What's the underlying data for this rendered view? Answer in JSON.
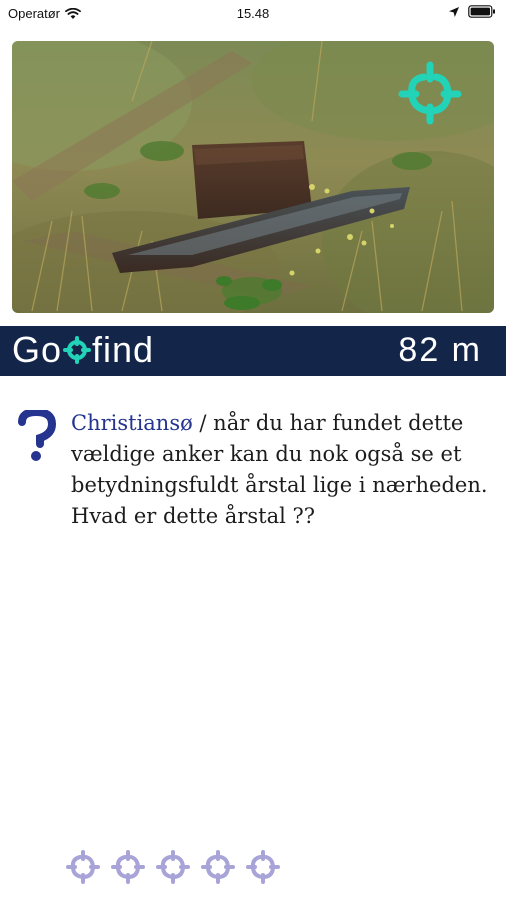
{
  "status_bar": {
    "carrier": "Operatør",
    "time": "15.48"
  },
  "brand": {
    "logo_left": "Go",
    "logo_right": "find",
    "distance": "82 m",
    "bar_color": "#13264a"
  },
  "clue": {
    "place": "Christiansø",
    "text": " / når du har fundet dette vældige anker kan du nok også se et betydningsfuldt årstal lige i nærheden. Hvad er dette årstal ??",
    "accent_color": "#24348f"
  },
  "icons": {
    "target": "crosshair-target-icon",
    "question": "question-mark-icon",
    "attempt": "crosshair-attempt-icon"
  },
  "colors": {
    "target_teal": "#22d3b7",
    "attempt_lavender": "#a8a4d8"
  },
  "attempts": {
    "remaining": 5
  }
}
